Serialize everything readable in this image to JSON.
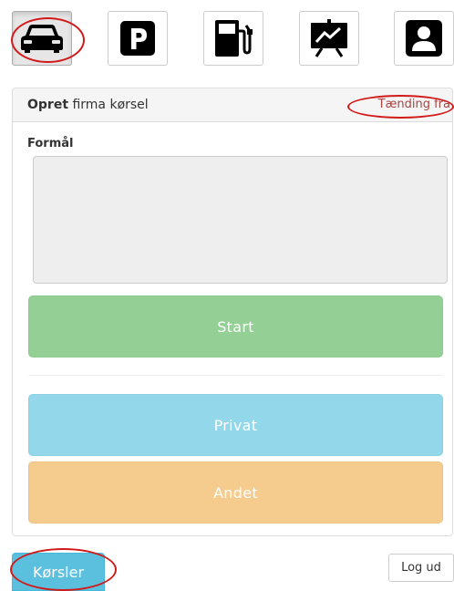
{
  "toolbar": {
    "buttons": [
      {
        "icon": "car-icon",
        "active": true
      },
      {
        "icon": "parking-icon",
        "active": false
      },
      {
        "icon": "fuel-pump-icon",
        "active": false
      },
      {
        "icon": "statistics-board-icon",
        "active": false
      },
      {
        "icon": "user-profile-icon",
        "active": false
      }
    ]
  },
  "panel": {
    "title_bold": "Opret",
    "title_rest": " firma kørsel",
    "ignition_status": "Tænding fra",
    "purpose_label": "Formål",
    "purpose_value": "",
    "start_label": "Start",
    "privat_label": "Privat",
    "andet_label": "Andet"
  },
  "footer": {
    "trips_label": "Kørsler",
    "logout_label": "Log ud"
  },
  "colors": {
    "start": "#94d095",
    "privat": "#93d7ea",
    "andet": "#f5cb8e",
    "trips": "#5bc0de",
    "annotation": "#d11a1a",
    "ignition": "#a94442"
  }
}
